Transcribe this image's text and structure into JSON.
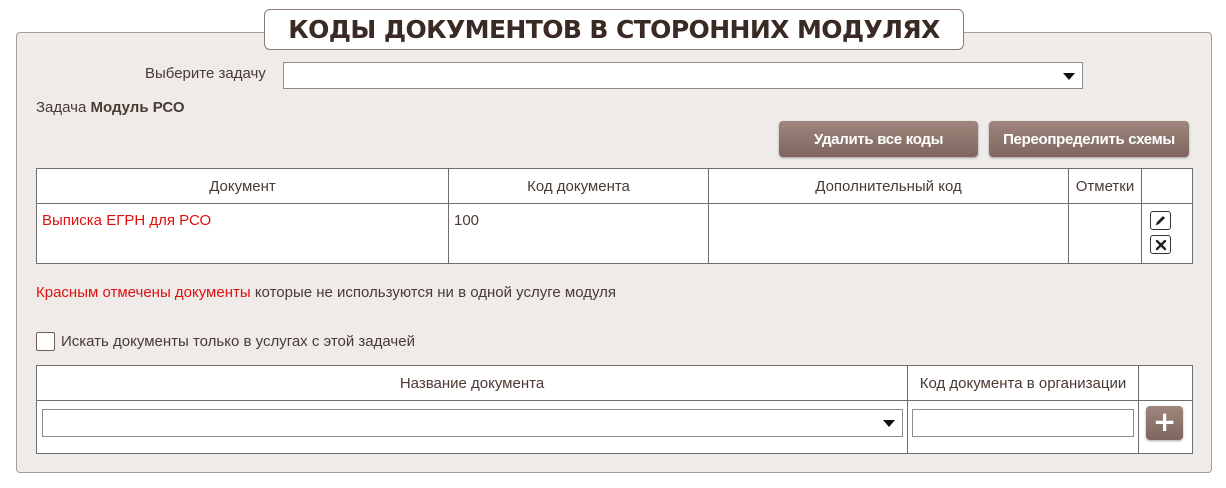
{
  "title": "КОДЫ ДОКУМЕНТОВ В СТОРОННИХ МОДУЛЯХ",
  "task_select": {
    "label": "Выберите задачу",
    "value": ""
  },
  "task_info": {
    "prefix": "Задача",
    "name": "Модуль РСО"
  },
  "buttons": {
    "delete_all": "Удалить все коды",
    "redefine": "Переопределить схемы"
  },
  "codes_table": {
    "headers": [
      "Документ",
      "Код документа",
      "Дополнительный код",
      "Отметки",
      ""
    ],
    "rows": [
      {
        "document": "Выписка ЕГРН для РСО",
        "code": "100",
        "extra_code": "",
        "marks": "",
        "unused": true
      }
    ]
  },
  "legend": {
    "red_part": "Красным отмечены документы",
    "rest": "которые не используются ни в одной услуге модуля"
  },
  "filter_checkbox": {
    "label": "Искать документы только в услугах с этой задачей",
    "checked": false
  },
  "add_table": {
    "headers": [
      "Название документа",
      "Код документа в организации",
      ""
    ],
    "document_select_value": "",
    "org_code_value": "",
    "add_label": "+"
  },
  "icons": [
    "chevron-down-icon",
    "pencil-icon",
    "close-icon",
    "plus-icon"
  ],
  "colors": {
    "accent": "#8a726a",
    "unused_doc": "#e01010",
    "panel_bg": "#efebe9",
    "text": "#4a3a33"
  }
}
